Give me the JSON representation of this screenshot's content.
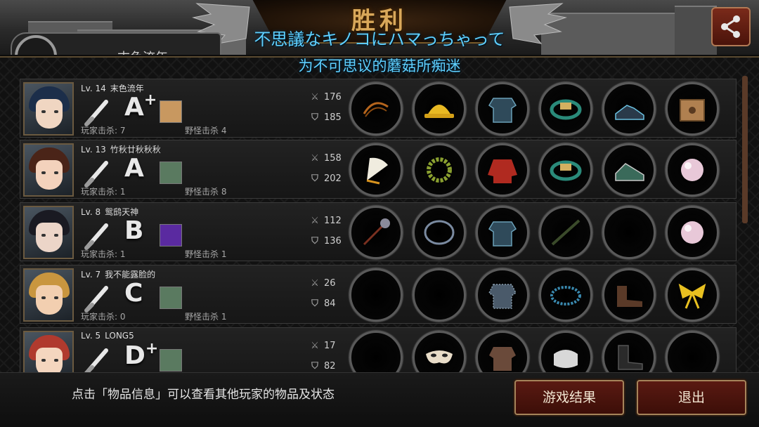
{
  "header": {
    "title": "胜利",
    "subtitle_jp": "不思議なキノコにハマっちゃって",
    "subtitle_cn": "为不可思议的蘑菇所痴迷",
    "tab_text": "末色流年"
  },
  "labels": {
    "level_prefix": "Lv.",
    "player_kills_prefix": "玩家击杀:",
    "monster_kills_prefix": "野怪击杀"
  },
  "players": [
    {
      "level": "Lv. 14",
      "name": "末色流年",
      "grade": "A",
      "grade_plus": "+",
      "player_kills": "玩家击杀: 7",
      "monster_kills": "野怪击杀 4",
      "attack": "176",
      "defense": "185",
      "items": [
        "whip-icon",
        "hard-hat-icon",
        "armor-icon",
        "bracelet-icon",
        "shoes-icon",
        "crate-icon"
      ]
    },
    {
      "level": "Lv. 13",
      "name": "竹秋廿秋秋秋",
      "grade": "A",
      "grade_plus": "",
      "player_kills": "玩家击杀: 1",
      "monster_kills": "野怪击杀 8",
      "attack": "158",
      "defense": "202",
      "items": [
        "fan-icon",
        "laurel-icon",
        "jacket-icon",
        "bracelet-icon",
        "sneakers-icon",
        "pearl-icon"
      ]
    },
    {
      "level": "Lv. 8",
      "name": "鸳鸱天神",
      "grade": "B",
      "grade_plus": "",
      "player_kills": "玩家击杀: 1",
      "monster_kills": "野怪击杀 1",
      "attack": "112",
      "defense": "136",
      "items": [
        "mace-icon",
        "ring-icon",
        "armor-icon",
        "stick-icon",
        "",
        "pearl-icon"
      ]
    },
    {
      "level": "Lv. 7",
      "name": "我不能露脸的",
      "grade": "C",
      "grade_plus": "",
      "player_kills": "玩家击杀: 0",
      "monster_kills": "野怪击杀 1",
      "attack": "26",
      "defense": "84",
      "items": [
        "",
        "",
        "chainmail-icon",
        "bead-bracelet-icon",
        "boots-icon",
        "ribbon-icon"
      ]
    },
    {
      "level": "Lv. 5",
      "name": "LONG5",
      "grade": "D",
      "grade_plus": "+",
      "player_kills": "",
      "monster_kills": "",
      "attack": "17",
      "defense": "82",
      "items": [
        "",
        "mask-icon",
        "leather-armor-icon",
        "gauntlet-icon",
        "combat-boots-icon",
        ""
      ]
    }
  ],
  "footer": {
    "hint": "点击「物品信息」可以查看其他玩家的物品及状态",
    "result_button": "游戏结果",
    "exit_button": "退出"
  },
  "colors": {
    "subtitle": "#5fd0ff",
    "title_gold": "#d9a85a",
    "button_red": "#5a1a12",
    "button_border": "#a6845a"
  }
}
